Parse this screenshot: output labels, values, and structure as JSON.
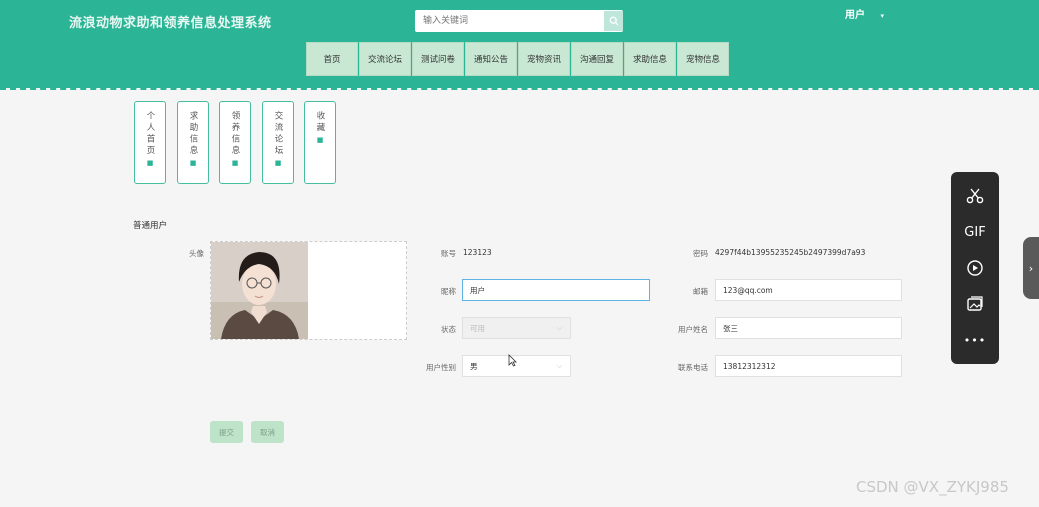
{
  "header": {
    "site_title": "流浪动物求助和领养信息处理系统",
    "search_placeholder": "输入关键词",
    "user_label": "用户",
    "user_caret": "▾"
  },
  "nav": [
    "首页",
    "交流论坛",
    "测试问卷",
    "通知公告",
    "宠物资讯",
    "沟通回复",
    "求助信息",
    "宠物信息"
  ],
  "side_menu": [
    "个人首页",
    "求助信息",
    "领养信息",
    "交流论坛",
    "收藏"
  ],
  "profile": {
    "section_title": "普通用户",
    "avatar_label": "头像",
    "account_label": "账号",
    "account_value": "123123",
    "password_label": "密码",
    "password_value": "4297f44b13955235245b2497399d7a93",
    "nickname_label": "昵称",
    "nickname_value": "用户",
    "email_label": "邮箱",
    "email_value": "123@qq.com",
    "status_label": "状态",
    "status_value": "可用",
    "realname_label": "用户姓名",
    "realname_value": "张三",
    "gender_label": "用户性别",
    "gender_value": "男",
    "phone_label": "联系电话",
    "phone_value": "13812312312"
  },
  "buttons": {
    "submit": "提交",
    "cancel": "取消"
  },
  "float_tools": [
    "scissors-icon",
    "gif-icon",
    "record-icon",
    "image-icon",
    "more-icon"
  ],
  "float_gif_text": "GIF",
  "float_more_text": "•••",
  "side_tab_glyph": "›",
  "watermark": "CSDN @VX_ZYKJ985",
  "colors": {
    "primary": "#2bb596",
    "nav_bg": "#c8e8d4",
    "button_bg": "#bde3c9"
  }
}
